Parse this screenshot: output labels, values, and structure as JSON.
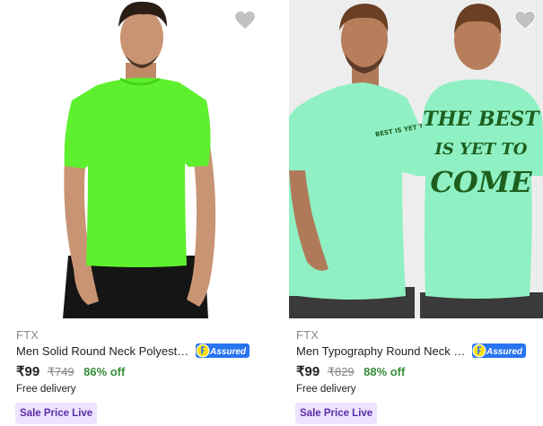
{
  "products": [
    {
      "brand": "FTX",
      "title": "Men Solid Round Neck Polyester...",
      "assured_label": "Assured",
      "price": "₹99",
      "mrp": "₹749",
      "discount": "86% off",
      "delivery": "Free delivery",
      "tag": "Sale Price Live",
      "shirt_color": "#5ef02e"
    },
    {
      "brand": "FTX",
      "title": "Men Typography Round Neck C...",
      "assured_label": "Assured",
      "price": "₹99",
      "mrp": "₹829",
      "discount": "88% off",
      "delivery": "Free delivery",
      "tag": "Sale Price Live",
      "shirt_color": "#8ff0c4",
      "print_text_front": "BEST IS YET TO COME",
      "print_text_back": [
        "THE BEST",
        "IS YET TO",
        "COME"
      ]
    }
  ],
  "colors": {
    "assured_blue": "#2874f0",
    "discount_green": "#388e3c",
    "tag_bg": "#ede4ff",
    "tag_text": "#5b2ea6",
    "wishlist_grey": "#c2c2c2"
  }
}
